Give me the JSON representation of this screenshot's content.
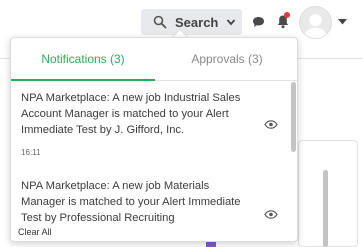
{
  "topbar": {
    "search_label": "Search",
    "notification_dot_color": "#e53935"
  },
  "tabs": [
    {
      "label": "Notifications (3)",
      "active": true
    },
    {
      "label": "Approvals (3)",
      "active": false
    }
  ],
  "notifications": [
    {
      "text": "NPA Marketplace: A new job Industrial Sales Account Manager is matched to your Alert Immediate Test by J. Gifford, Inc.",
      "time": "16:11"
    },
    {
      "text": "NPA Marketplace: A new job Materials Manager is matched to your Alert Immediate Test by Professional Recruiting",
      "time": ""
    }
  ],
  "footer": {
    "clear_all_label": "Clear All"
  },
  "colors": {
    "accent": "#2eac5a",
    "muted_tab": "#8a8a8a"
  }
}
